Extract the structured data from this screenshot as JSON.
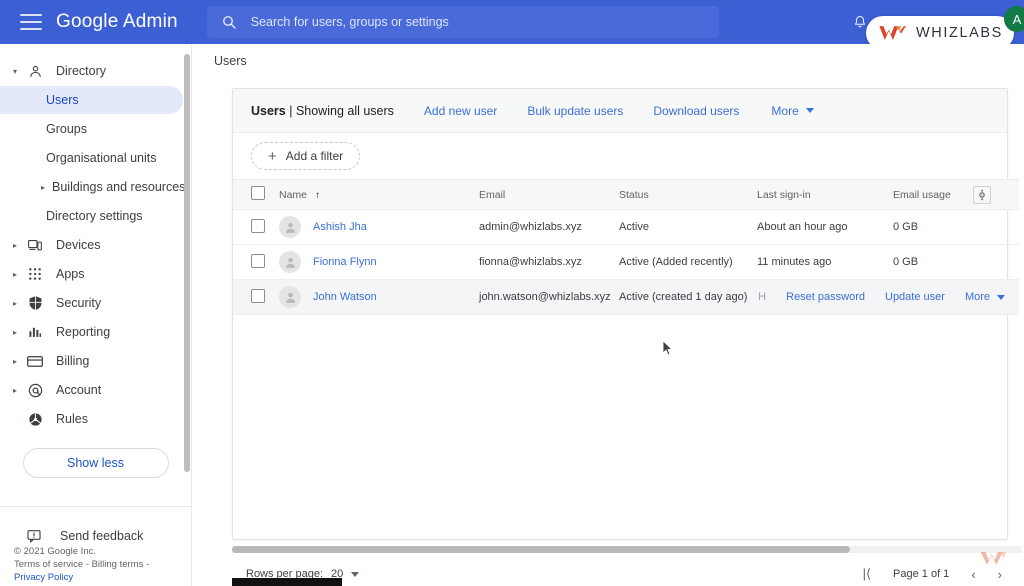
{
  "header": {
    "menu_label": "main-menu",
    "brand": "Google Admin",
    "search_placeholder": "Search for users, groups or settings",
    "search_value": "",
    "notification_label": "Notifications",
    "overlay_logo_text": "WHIZLABS",
    "avatar_initial": "A"
  },
  "sidebar": {
    "items": [
      {
        "label": "Directory",
        "icon": "person-icon",
        "caret": "▾",
        "level": 0,
        "selected": false
      },
      {
        "label": "Users",
        "icon": "",
        "caret": "",
        "level": 1,
        "selected": true
      },
      {
        "label": "Groups",
        "icon": "",
        "caret": "",
        "level": 1,
        "selected": false
      },
      {
        "label": "Organisational units",
        "icon": "",
        "caret": "",
        "level": 1,
        "selected": false
      },
      {
        "label": "Buildings and resources",
        "icon": "",
        "caret": "▸",
        "level": 1,
        "selected": false
      },
      {
        "label": "Directory settings",
        "icon": "",
        "caret": "",
        "level": 1,
        "selected": false
      },
      {
        "label": "Devices",
        "icon": "devices-icon",
        "caret": "▸",
        "level": 0,
        "selected": false
      },
      {
        "label": "Apps",
        "icon": "apps-grid-icon",
        "caret": "▸",
        "level": 0,
        "selected": false
      },
      {
        "label": "Security",
        "icon": "shield-icon",
        "caret": "▸",
        "level": 0,
        "selected": false
      },
      {
        "label": "Reporting",
        "icon": "bar-chart-icon",
        "caret": "▸",
        "level": 0,
        "selected": false
      },
      {
        "label": "Billing",
        "icon": "credit-card-icon",
        "caret": "▸",
        "level": 0,
        "selected": false
      },
      {
        "label": "Account",
        "icon": "at-sign-icon",
        "caret": "▸",
        "level": 0,
        "selected": false
      },
      {
        "label": "Rules",
        "icon": "rules-icon",
        "caret": "",
        "level": 0,
        "selected": false
      }
    ],
    "show_less_label": "Show less",
    "send_feedback_label": "Send feedback",
    "legal": {
      "copyright": "© 2021 Google Inc.",
      "links_line": "Terms of service - Billing terms -",
      "links_line2": "Privacy Policy"
    }
  },
  "breadcrumb": {
    "current": "Users"
  },
  "toolbar": {
    "title_bold": "Users",
    "title_rest": " | Showing all users",
    "add_new_user": "Add new user",
    "bulk_update_users": "Bulk update users",
    "download_users": "Download users",
    "more": "More"
  },
  "filter": {
    "label": "Add a filter",
    "plus": "+"
  },
  "table": {
    "columns": [
      "Name",
      "Email",
      "Status",
      "Last sign-in",
      "Email usage"
    ],
    "sort_column": "Name",
    "sort_arrow": "↑",
    "settings_icon": "table-settings-icon",
    "rows": [
      {
        "name": "Ashish Jha",
        "email": "admin@whizlabs.xyz",
        "status": "Active",
        "last_sign_in": "About an hour ago",
        "email_usage": "0 GB",
        "hovered": false
      },
      {
        "name": "Fionna Flynn",
        "email": "fionna@whizlabs.xyz",
        "status": "Active (Added recently)",
        "last_sign_in": "11 minutes ago",
        "email_usage": "0 GB",
        "hovered": false
      },
      {
        "name": "John Watson",
        "email": "john.watson@whizlabs.xyz",
        "status": "Active (created 1 day ago)",
        "last_sign_in": "H",
        "email_usage": "",
        "hovered": true
      }
    ],
    "row_actions": {
      "reset_password": "Reset password",
      "update_user": "Update user",
      "more": "More"
    }
  },
  "pagination": {
    "rows_per_page_label": "Rows per page:",
    "rows_per_page_value": "20",
    "first_page_icon": "|⟨",
    "page_status": "Page 1 of 1",
    "prev_icon": "‹",
    "next_icon": "›"
  },
  "colors": {
    "header_blue": "#3c5fd4",
    "link_blue": "#3c6fd6",
    "selected_nav_bg": "#e3e9fb",
    "selected_nav_text": "#1a47b8",
    "avatar_green": "#127a45",
    "whiz_orange": "#e2542a"
  }
}
